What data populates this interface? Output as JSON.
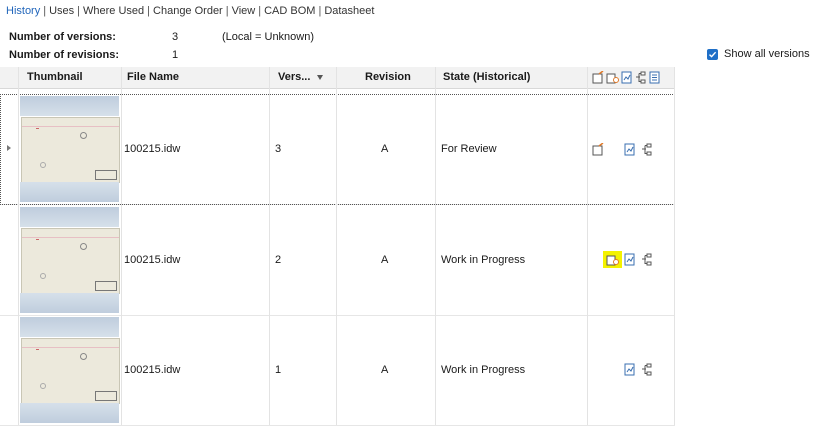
{
  "tabs": [
    {
      "label": "History",
      "active": true
    },
    {
      "label": "Uses",
      "active": false
    },
    {
      "label": "Where Used",
      "active": false
    },
    {
      "label": "Change Order",
      "active": false
    },
    {
      "label": "View",
      "active": false
    },
    {
      "label": "CAD BOM",
      "active": false
    },
    {
      "label": "Datasheet",
      "active": false
    }
  ],
  "summary": {
    "versions_label": "Number of versions:",
    "versions_value": "3",
    "versions_note": "(Local = Unknown)",
    "revisions_label": "Number of revisions:",
    "revisions_value": "1"
  },
  "show_all_versions": {
    "label": "Show all versions",
    "checked": true
  },
  "columns": {
    "thumbnail": "Thumbnail",
    "file_name": "File Name",
    "version": "Vers...",
    "revision": "Revision",
    "state": "State (Historical)"
  },
  "rows": [
    {
      "file_name": "100215.idw",
      "version": "3",
      "revision": "A",
      "state": "For Review",
      "selected": true,
      "highlight": false
    },
    {
      "file_name": "100215.idw",
      "version": "2",
      "revision": "A",
      "state": "Work in Progress",
      "selected": false,
      "highlight": true
    },
    {
      "file_name": "100215.idw",
      "version": "1",
      "revision": "A",
      "state": "Work in Progress",
      "selected": false,
      "highlight": false
    }
  ],
  "colors": {
    "accent": "#2266bb",
    "checkbox": "#1f6fc7",
    "highlight": "#f4f200",
    "icon_orange": "#e07a2a",
    "icon_blue": "#3a6fb0"
  }
}
